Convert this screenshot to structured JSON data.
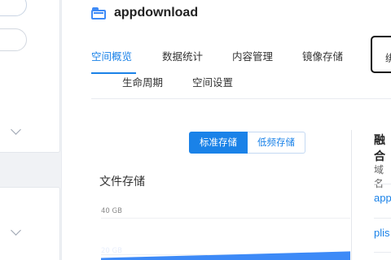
{
  "bucket": {
    "name": "appdownload",
    "icon": "bucket-folder-icon"
  },
  "tabs": {
    "row1": [
      "空间概览",
      "数据统计",
      "内容管理",
      "镜像存储"
    ],
    "row2": [
      "生命周期",
      "空间设置"
    ],
    "boxed": "绑",
    "active": "空间概览"
  },
  "storage_toggle": {
    "standard": "标准存储",
    "infrequent": "低频存储",
    "selected": "标准存储"
  },
  "file_storage": {
    "title": "文件存储",
    "y_ticks": [
      "40 GB",
      "20 GB"
    ]
  },
  "chart_data": {
    "type": "area",
    "title": "文件存储",
    "y_ticks": [
      "40 GB",
      "20 GB"
    ],
    "series": [
      {
        "values": [
          18,
          18.6,
          19.2,
          19.8,
          20.4,
          21,
          21.6
        ]
      }
    ],
    "color": "#3d8af7"
  },
  "domain_panel": {
    "title": "融合",
    "label": "域名",
    "links": [
      "app",
      "plis"
    ]
  },
  "colors": {
    "accent": "#1a82e8",
    "chart_fill": "#3d8af7"
  },
  "sidebar": {
    "chevron_icon": "chevron-down-icon"
  }
}
